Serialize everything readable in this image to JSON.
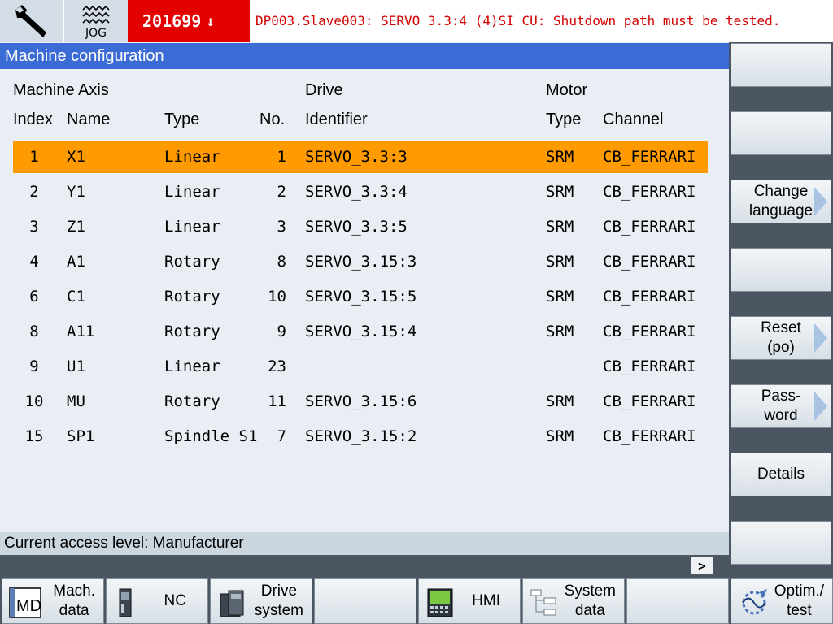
{
  "header": {
    "operating_area_icon": "wrench-icon",
    "mode_icon": "jog-wave-icon",
    "mode_label": "JOG",
    "alarm_number": "201699",
    "alarm_arrow": "↓",
    "alarm_message": "DP003.Slave003: SERVO_3.3:4 (4)SI CU: Shutdown path must be tested.",
    "alarm_color": "#e20000"
  },
  "title": "Machine configuration",
  "table": {
    "group_headers": {
      "machine_axis": "Machine Axis",
      "drive": "Drive",
      "motor": "Motor"
    },
    "columns": {
      "index": "Index",
      "name": "Name",
      "type": "Type",
      "no": "No.",
      "identifier": "Identifier",
      "motor_type": "Type",
      "channel": "Channel"
    },
    "rows": [
      {
        "index": "1",
        "name": "X1",
        "type": "Linear",
        "no": "1",
        "identifier": "SERVO_3.3:3",
        "motor_type": "SRM",
        "channel": "CB_FERRARI"
      },
      {
        "index": "2",
        "name": "Y1",
        "type": "Linear",
        "no": "2",
        "identifier": "SERVO_3.3:4",
        "motor_type": "SRM",
        "channel": "CB_FERRARI"
      },
      {
        "index": "3",
        "name": "Z1",
        "type": "Linear",
        "no": "3",
        "identifier": "SERVO_3.3:5",
        "motor_type": "SRM",
        "channel": "CB_FERRARI"
      },
      {
        "index": "4",
        "name": "A1",
        "type": "Rotary",
        "no": "8",
        "identifier": "SERVO_3.15:3",
        "motor_type": "SRM",
        "channel": "CB_FERRARI"
      },
      {
        "index": "6",
        "name": "C1",
        "type": "Rotary",
        "no": "10",
        "identifier": "SERVO_3.15:5",
        "motor_type": "SRM",
        "channel": "CB_FERRARI"
      },
      {
        "index": "8",
        "name": "A11",
        "type": "Rotary",
        "no": "9",
        "identifier": "SERVO_3.15:4",
        "motor_type": "SRM",
        "channel": "CB_FERRARI"
      },
      {
        "index": "9",
        "name": "U1",
        "type": "Linear",
        "no": "23",
        "identifier": "",
        "motor_type": "",
        "channel": "CB_FERRARI"
      },
      {
        "index": "10",
        "name": "MU",
        "type": "Rotary",
        "no": "11",
        "identifier": "SERVO_3.15:6",
        "motor_type": "SRM",
        "channel": "CB_FERRARI"
      },
      {
        "index": "15",
        "name": "SP1",
        "type": "Spindle S1",
        "no": "7",
        "identifier": "SERVO_3.15:2",
        "motor_type": "SRM",
        "channel": "CB_FERRARI"
      }
    ],
    "selected_row": 0,
    "selection_color": "#ff9b00"
  },
  "status": {
    "access_level": "Current access level: Manufacturer",
    "more_label": ">"
  },
  "vertical_softkeys": [
    {
      "label": "",
      "arrow": false
    },
    {
      "label": "",
      "arrow": false
    },
    {
      "label": "Change\nlanguage",
      "arrow": true
    },
    {
      "label": "",
      "arrow": false
    },
    {
      "label": "Reset\n(po)",
      "arrow": true
    },
    {
      "label": "Pass-\nword",
      "arrow": true
    },
    {
      "label": "Details",
      "arrow": false
    },
    {
      "label": "",
      "arrow": false
    }
  ],
  "horizontal_softkeys": [
    {
      "label": "Mach.\ndata",
      "icon": "md-icon"
    },
    {
      "label": "NC",
      "icon": "nc-unit-icon"
    },
    {
      "label": "Drive\nsystem",
      "icon": "drive-unit-icon"
    },
    {
      "label": "",
      "icon": ""
    },
    {
      "label": "HMI",
      "icon": "hmi-panel-icon"
    },
    {
      "label": "System\ndata",
      "icon": "tree-icon"
    },
    {
      "label": "",
      "icon": ""
    },
    {
      "label": "Optim./\ntest",
      "icon": "optimization-icon"
    }
  ]
}
